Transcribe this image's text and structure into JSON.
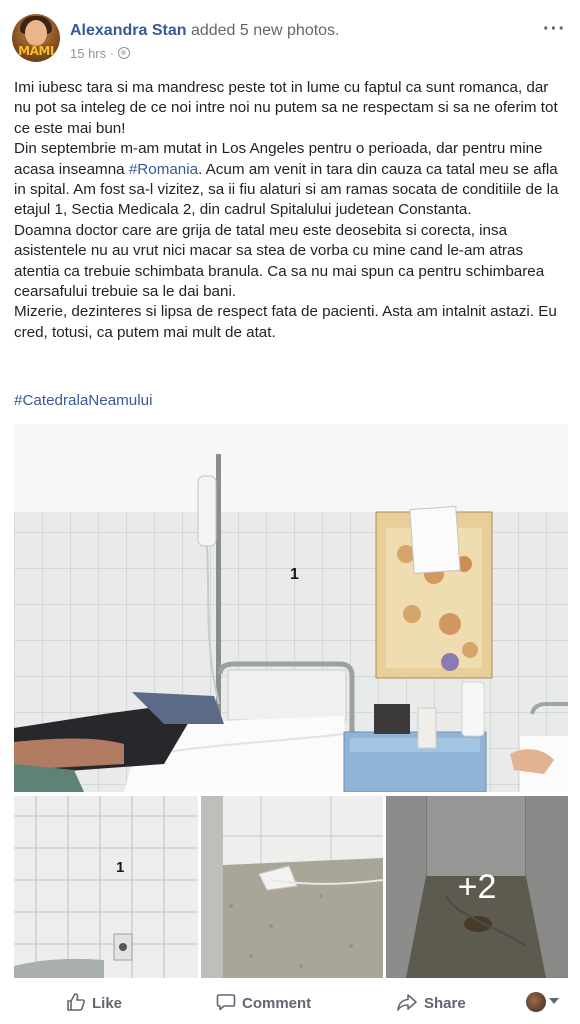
{
  "header": {
    "avatar_text": "MAMI",
    "author_name": "Alexandra Stan",
    "action": "added 5 new photos.",
    "time": "15 hrs",
    "separator": "·",
    "more_label": "···"
  },
  "post": {
    "paragraphs": [
      "Imi iubesc tara si ma mandresc peste tot in lume cu faptul ca sunt romanca, dar nu pot sa inteleg de ce noi intre noi nu putem sa ne respectam si sa ne oferim tot ce este mai bun!",
      "meu se afla in spital. Am fost sa-l vizitez, sa ii fiu alaturi si am ramas socata de conditiile de la etajul 1, Sectia Medicala 2, din cadrul Spitalului judetean Constanta.",
      "Doamna doctor care are grija de tatal meu este deosebita si corecta, insa asistentele nu au vrut nici macar sa stea de vorba cu mine cand le-am atras atentia ca trebuie schimbata branula. Ca sa nu mai spun ca pentru schimbarea cearsafului trebuie sa le dai bani.",
      "Mizerie, dezinteres si lipsa de respect fata de pacienti. Asta am intalnit astazi. Eu cred, totusi, ca putem mai mult de atat."
    ],
    "para2_before": "Din septembrie m-am mutat in Los Angeles pentru o perioada, dar pentru mine acasa inseamna ",
    "para2_hashtag": "#Romania",
    "para2_after": ". Acum am venit in tara din cauza ca tatal ",
    "hashtag": "#CatedralaNeamului"
  },
  "photos": {
    "main_label": "1",
    "thumb1_label": "1",
    "more_count": "+2"
  },
  "actions": {
    "like": "Like",
    "comment": "Comment",
    "share": "Share"
  },
  "colors": {
    "link": "#385898",
    "text": "#1d2129",
    "muted": "#90949c"
  }
}
